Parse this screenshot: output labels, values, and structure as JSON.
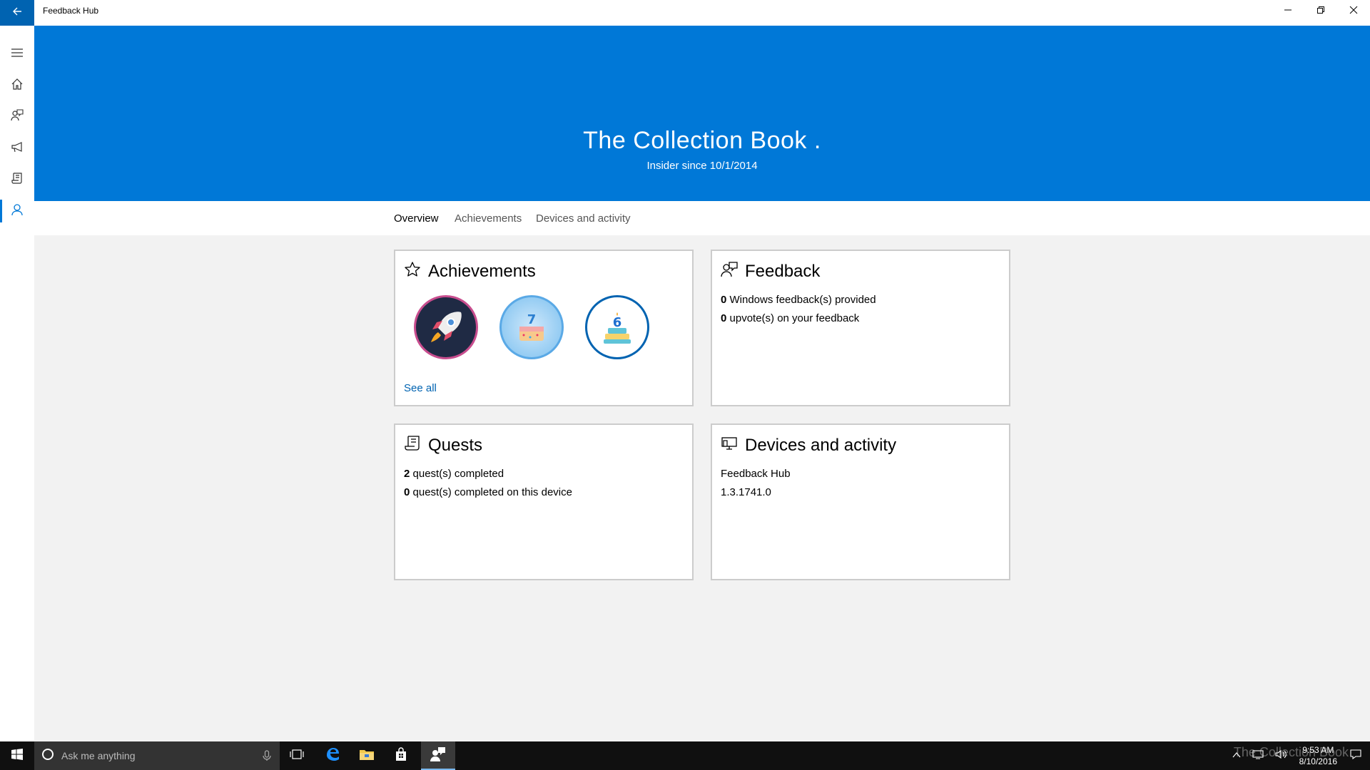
{
  "window": {
    "title": "Feedback Hub",
    "back_label": "Back",
    "minimize_label": "Minimize",
    "restore_label": "Restore",
    "close_label": "Close"
  },
  "rail": {
    "items": [
      {
        "name": "menu",
        "icon": "hamburger-icon"
      },
      {
        "name": "home",
        "icon": "home-icon"
      },
      {
        "name": "feedback",
        "icon": "feedback-icon"
      },
      {
        "name": "announcements",
        "icon": "megaphone-icon"
      },
      {
        "name": "quests",
        "icon": "quest-scroll-icon"
      },
      {
        "name": "profile",
        "icon": "person-icon",
        "active": true
      }
    ]
  },
  "hero": {
    "name": "The Collection Book .",
    "subtitle": "Insider since 10/1/2014",
    "color": "#0078d7"
  },
  "tabs": [
    {
      "label": "Overview",
      "active": true
    },
    {
      "label": "Achievements",
      "active": false
    },
    {
      "label": "Devices and activity",
      "active": false
    }
  ],
  "cards": {
    "achievements": {
      "title": "Achievements",
      "icon": "star-icon",
      "badges": [
        {
          "name": "rocket-badge"
        },
        {
          "name": "cake-7-badge",
          "label": "7"
        },
        {
          "name": "cake-6-badge",
          "label": "6"
        }
      ],
      "see_all": "See all"
    },
    "feedback": {
      "title": "Feedback",
      "icon": "feedback-icon",
      "line1_count": "0",
      "line1_text": " Windows feedback(s) provided",
      "line2_count": "0",
      "line2_text": " upvote(s) on your feedback"
    },
    "quests": {
      "title": "Quests",
      "icon": "quest-scroll-icon",
      "line1_count": "2",
      "line1_text": " quest(s) completed",
      "line2_count": "0",
      "line2_text": " quest(s) completed on this device"
    },
    "devices": {
      "title": "Devices and activity",
      "icon": "device-icon",
      "line1": "Feedback Hub",
      "line2": "1.3.1741.0"
    }
  },
  "taskbar": {
    "search_placeholder": "Ask me anything",
    "time": "9:53 AM",
    "date": "8/10/2016",
    "apps": [
      "task-view-icon",
      "edge-icon",
      "file-explorer-icon",
      "store-icon",
      "feedback-hub-icon"
    ],
    "watermark": "The Collection Book"
  }
}
